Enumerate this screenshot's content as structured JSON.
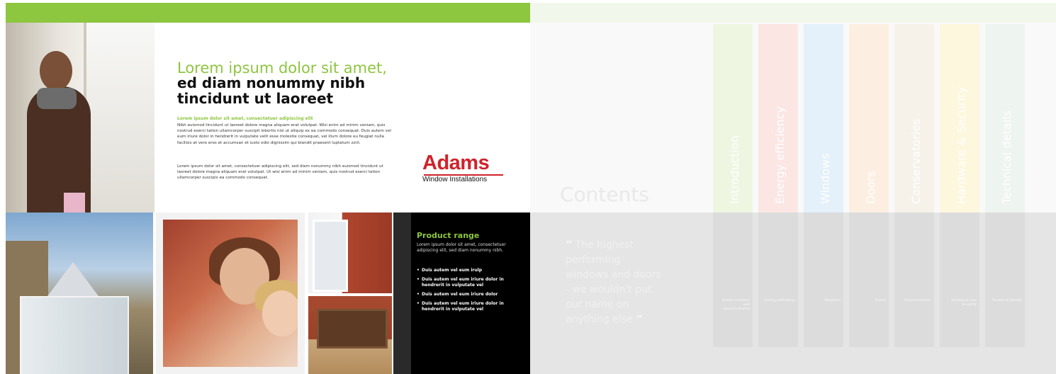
{
  "left_page": {
    "title_line1": "Lorem ipsum dolor sit amet,",
    "title_line2": "ed diam nonummy nibh tincidunt ut laoreet",
    "subhead": "Lorem ipsum dolor sit amet, consectetuer adipiscing elit",
    "body1": "Nibh euismod tincidunt ut laoreet dolore magna aliquam erat volutpat. Wisi enim ad minim veniam, quis nostrud exerci tation ullamcorper suscipit lobortis nisl ut aliquip ex ea commodo consequat. Duis autem vel eum iriure dolor in hendrerit in vulputate velit esse molestie consequat, vel illum dolore eu feugiat nulla facilisis at vero eros et accumsan et iusto odio dignissim qui blandit praesent luptatum zzril.",
    "body2": "Lorem ipsum dolor sit amet, consectetuer adipiscing elit, sed diam nonummy nibh euismod tincidunt ut laoreet dolore magna aliquam erat volutpat. Ut wisi enim ad minim veniam, quis nostrud exerci tation ullamcorper suscipix ea commodo consequat.",
    "logo": {
      "name": "Adams",
      "sub": "Window Installations"
    },
    "product_range": {
      "title": "Product range",
      "intro": "Lorem ipsum dolor sit amet, consectetuer adipiscing elit, sed diam nonummy nibh.",
      "items": [
        "Duis autem vel eum irulp",
        "Duis autem vel eum iriure dolor in hendrerit in vulputate vel",
        "Duis autem vel eum iriure dolor",
        "Duis autem vel eum iriure dolor in hendrerit in vulputate vel"
      ]
    }
  },
  "right_page": {
    "contents_label": "Contents",
    "quote": "The highest performing windows and doors - we wouldn't put our name on anything else",
    "quote_open": "”",
    "quote_close": "”",
    "tabs": [
      {
        "label": "Introduction",
        "color": "#eef6e2",
        "caption": "Green windows and conservatories"
      },
      {
        "label": "Energy efficiency",
        "color": "#fbe6e4",
        "caption": "Energy efficiency"
      },
      {
        "label": "Windows",
        "color": "#e4f0fa",
        "caption": "Windows"
      },
      {
        "label": "Doors",
        "color": "#fcefe2",
        "caption": "Doors"
      },
      {
        "label": "Conservatories",
        "color": "#f6f2ea",
        "caption": "Conservatories"
      },
      {
        "label": "Hardware & Security",
        "color": "#fcf7dd",
        "caption": "Hardware and Security"
      },
      {
        "label": "Technical details",
        "color": "#eef4ef",
        "caption": "Technical details"
      }
    ]
  },
  "colors": {
    "accent_green": "#8dc63f",
    "logo_red": "#d0222b"
  }
}
